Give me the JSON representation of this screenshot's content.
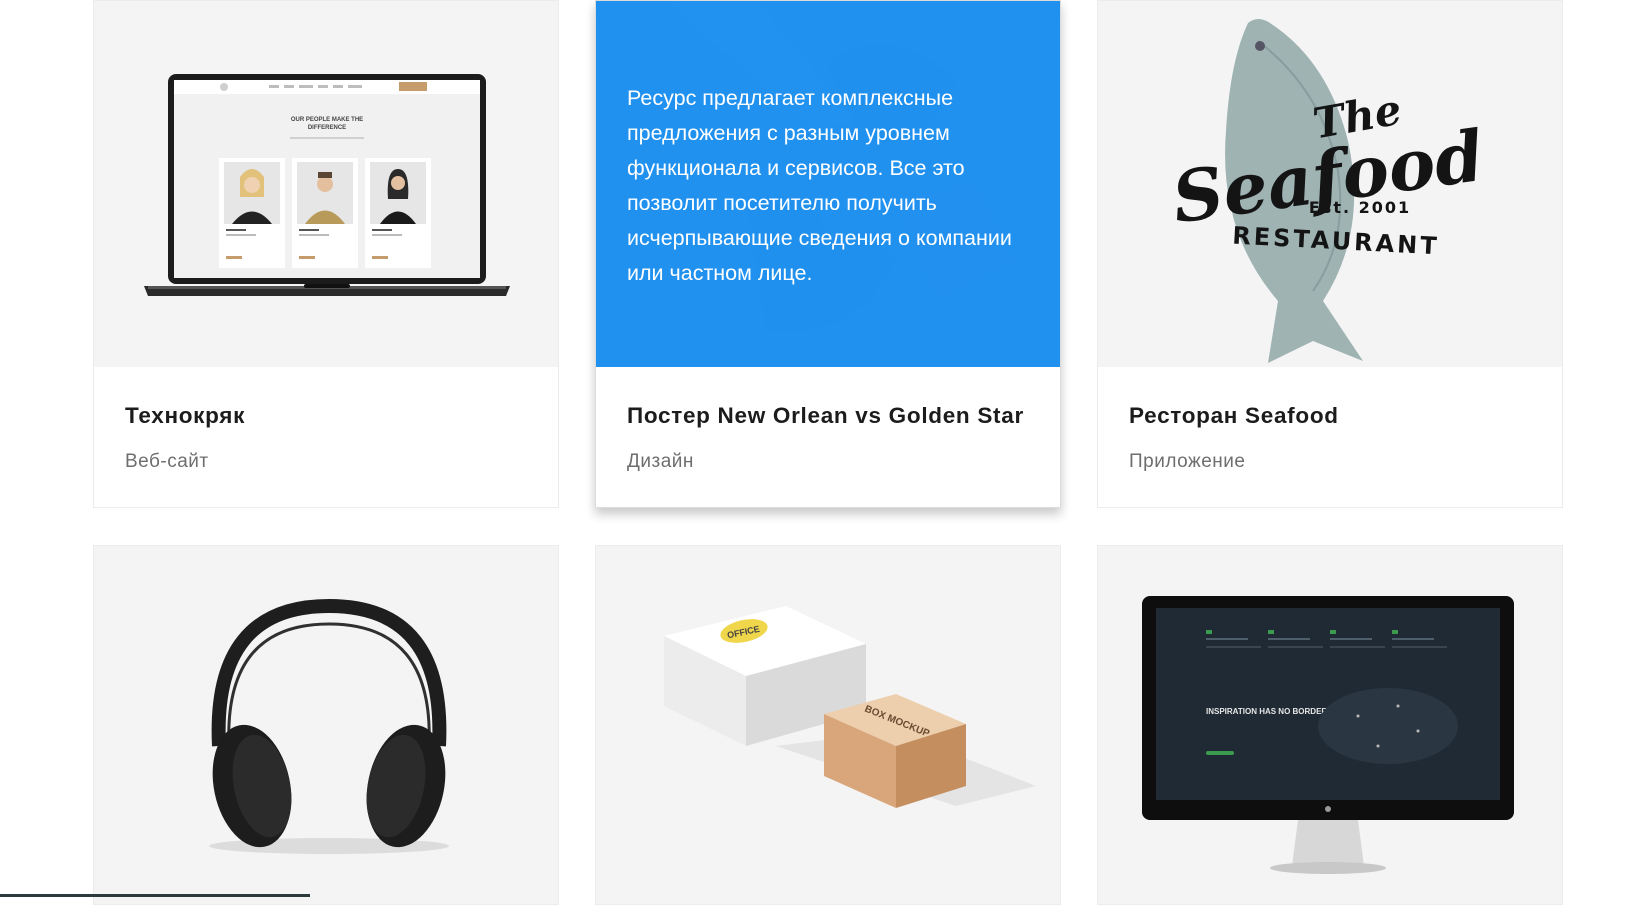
{
  "portfolio": {
    "items": [
      {
        "title": "Технокряк",
        "category": "Веб-сайт",
        "image": "laptop-mockup"
      },
      {
        "title": "Постер New Orlean vs Golden Star",
        "category": "Дизайн",
        "image": "poster-art",
        "overlay_text": "Ресурс предлагает комплексные предложения с разным уровнем функционала и сервисов. Все это позволит посетителю получить исчерпывающие сведения о компании или частном лице."
      },
      {
        "title": "Ресторан Seafood",
        "category": "Приложение",
        "image": "seafood-logo"
      },
      {
        "image": "headphones"
      },
      {
        "image": "box-mockup"
      },
      {
        "image": "monitor-mockup"
      }
    ],
    "mockup_text": {
      "laptop_heading": "OUR PEOPLE MAKE THE DIFFERENCE",
      "seafood_line1": "The",
      "seafood_line2": "Seafood",
      "seafood_est": "Est. 2001",
      "seafood_restaurant": "RESTAURANT",
      "box_sticker": "OFFICE",
      "box_lid": "BOX MOCKUP",
      "monitor_heading": "INSPIRATION HAS NO BORDERS"
    }
  },
  "colors": {
    "overlay": "#2191F0",
    "card_bg": "#F5F5F5",
    "title": "#1C1C1C",
    "category": "#6E6E6E"
  }
}
